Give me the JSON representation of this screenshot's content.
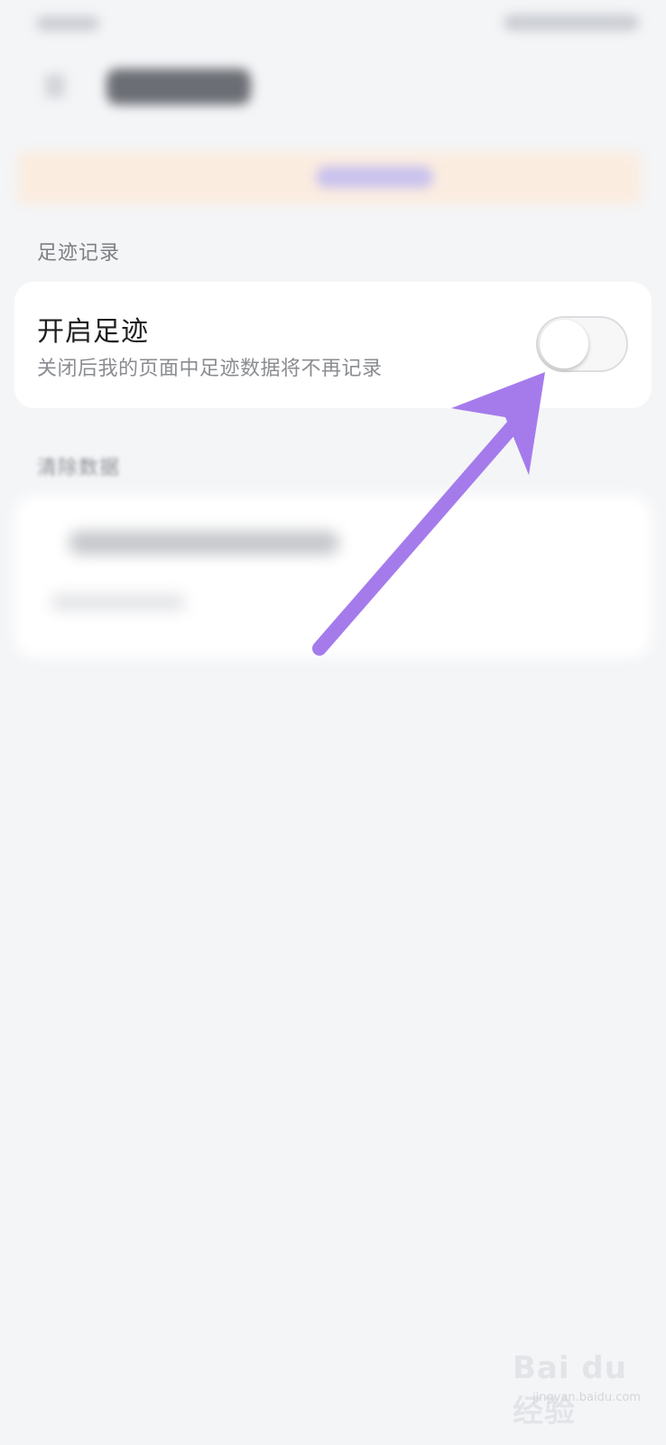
{
  "section_footprint": {
    "title": "足迹记录"
  },
  "footprint_setting": {
    "label": "开启足迹",
    "description": "关闭后我的页面中足迹数据将不再记录",
    "toggle_on": false
  },
  "section_clear": {
    "title": "清除数据"
  },
  "annotation": {
    "arrow_color": "#a57bec"
  },
  "watermark": {
    "brand": "Bai du 经验",
    "url": "jingyan.baidu.com"
  }
}
